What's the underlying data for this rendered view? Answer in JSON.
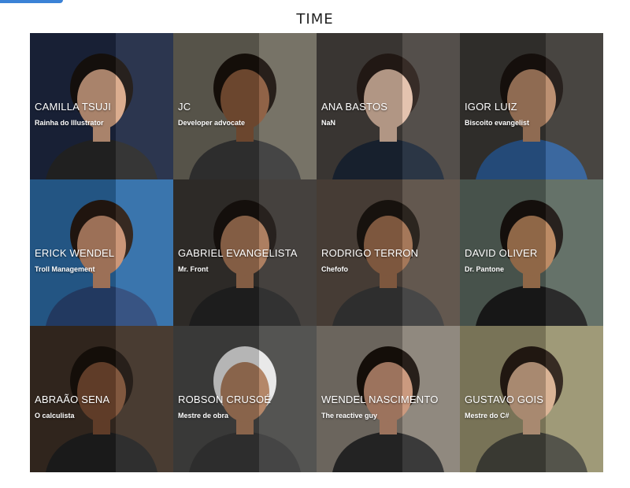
{
  "section": {
    "title": "TIME"
  },
  "colors": {
    "accent": "#3b82d6"
  },
  "team": [
    {
      "name": "CAMILLA TSUJI",
      "role": "Rainha do Illustrator",
      "bg": "#1f2a44",
      "skin": "#d9a889",
      "hair": "#1a1410",
      "shirt": "#2a2a2a"
    },
    {
      "name": "JC",
      "role": "Developer advocate",
      "bg": "#6f6b5e",
      "skin": "#8a5a3c",
      "hair": "#1a120c",
      "shirt": "#3a3a3a"
    },
    {
      "name": "ANA BASTOS",
      "role": "NaN",
      "bg": "#4a4440",
      "skin": "#e3c0aa",
      "hair": "#2b1f1a",
      "shirt": "#1e2a3a"
    },
    {
      "name": "IGOR LUIZ",
      "role": "Biscoito evangelist",
      "bg": "#3d3a36",
      "skin": "#b88a6a",
      "hair": "#1b1410",
      "shirt": "#2f5f9a"
    },
    {
      "name": "ERICK WENDEL",
      "role": "Troll Management",
      "bg": "#2e6da8",
      "skin": "#c89070",
      "hair": "#2a1c14",
      "shirt": "#2c4a7c"
    },
    {
      "name": "GABRIEL EVANGELISTA",
      "role": "Mr. Front",
      "bg": "#3a3632",
      "skin": "#a87858",
      "hair": "#1a1410",
      "shirt": "#262626"
    },
    {
      "name": "RODRIGO TERRON",
      "role": "Chefofo",
      "bg": "#5a4e44",
      "skin": "#a07050",
      "hair": "#1e1812",
      "shirt": "#3c3c3c"
    },
    {
      "name": "DAVID OLIVER",
      "role": "Dr. Pantone",
      "bg": "#5c6a60",
      "skin": "#b8845c",
      "hair": "#1a1410",
      "shirt": "#1e1e1e"
    },
    {
      "name": "ABRAÃO SENA",
      "role": "O calculista",
      "bg": "#3e3026",
      "skin": "#7a4e34",
      "hair": "#1a120c",
      "shirt": "#222222"
    },
    {
      "name": "ROBSON CRUSOÉ",
      "role": "Mestre de obra",
      "bg": "#4a4a48",
      "skin": "#b08060",
      "hair": "#e8e8e8",
      "shirt": "#3a3a3a"
    },
    {
      "name": "WENDEL NASCIMENTO",
      "role": "The reactive guy",
      "bg": "#8a8278",
      "skin": "#c89478",
      "hair": "#1a120c",
      "shirt": "#2e2e2e"
    },
    {
      "name": "GUSTAVO GOIS",
      "role": "Mestre do C#",
      "bg": "#9a9470",
      "skin": "#d8b090",
      "hair": "#2a1e16",
      "shirt": "#4a4a40"
    }
  ]
}
